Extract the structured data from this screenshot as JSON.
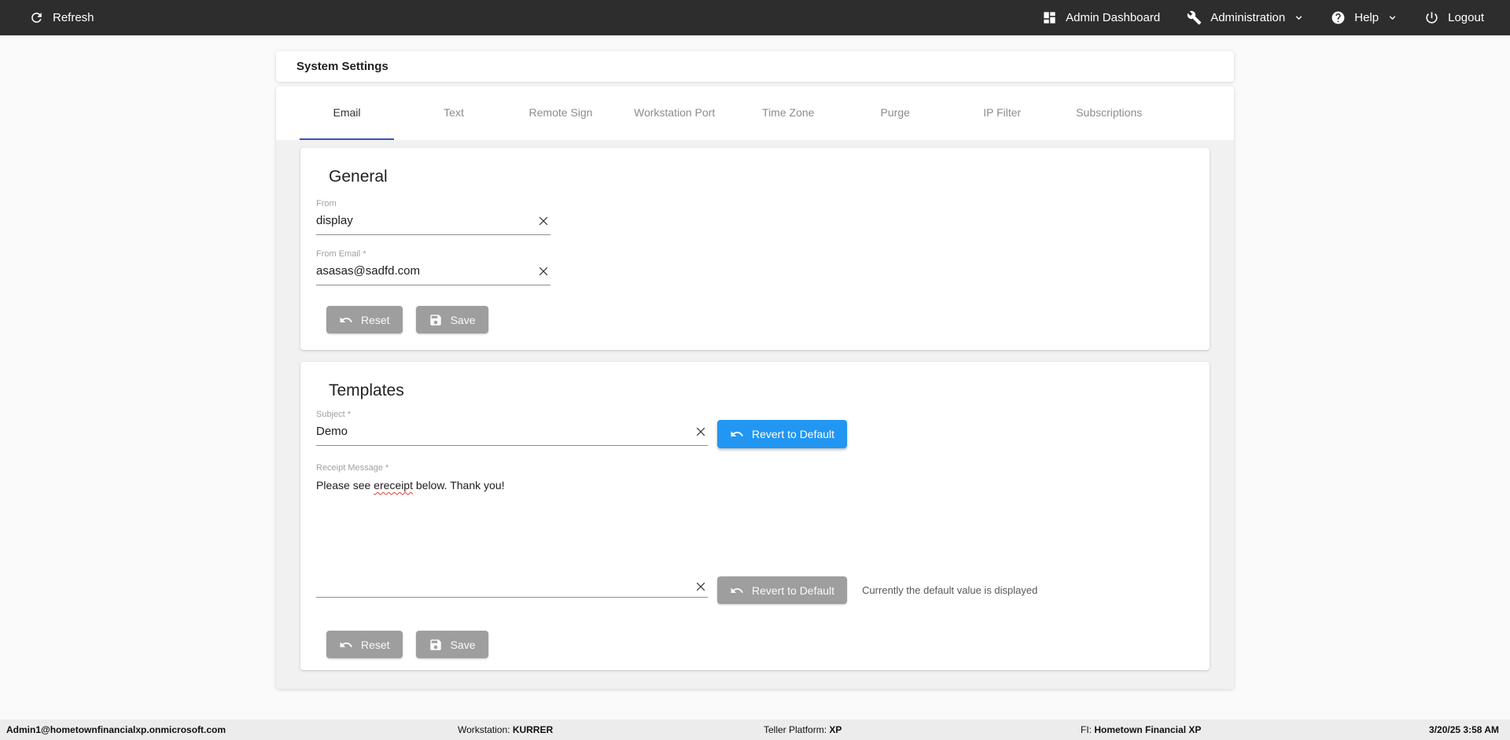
{
  "topbar": {
    "refresh": "Refresh",
    "admin_dashboard": "Admin Dashboard",
    "administration": "Administration",
    "help": "Help",
    "logout": "Logout"
  },
  "page": {
    "title": "System Settings"
  },
  "tabs": [
    {
      "label": "Email",
      "active": true
    },
    {
      "label": "Text",
      "active": false
    },
    {
      "label": "Remote Sign",
      "active": false
    },
    {
      "label": "Workstation Port",
      "active": false
    },
    {
      "label": "Time Zone",
      "active": false
    },
    {
      "label": "Purge",
      "active": false
    },
    {
      "label": "IP Filter",
      "active": false
    },
    {
      "label": "Subscriptions",
      "active": false
    }
  ],
  "general": {
    "heading": "General",
    "from_label": "From",
    "from_value": "display",
    "from_email_label": "From Email *",
    "from_email_value": "asasas@sadfd.com",
    "reset_label": "Reset",
    "save_label": "Save"
  },
  "templates": {
    "heading": "Templates",
    "subject_label": "Subject *",
    "subject_value": "Demo",
    "revert_label": "Revert to Default",
    "receipt_label": "Receipt Message *",
    "receipt_prefix": "Please see ",
    "receipt_misspelled": "ereceipt",
    "receipt_suffix": " below. Thank you!",
    "revert_disabled_label": "Revert to Default",
    "default_note": "Currently the default value is displayed",
    "reset_label": "Reset",
    "save_label": "Save"
  },
  "footer": {
    "user": "Admin1@hometownfinancialxp.onmicrosoft.com",
    "workstation_label": "Workstation: ",
    "workstation_value": "KURRER",
    "platform_label": "Teller Platform: ",
    "platform_value": "XP",
    "fi_label": "FI: ",
    "fi_value": "Hometown Financial XP",
    "datetime": "3/20/25 3:58 AM"
  },
  "colors": {
    "topbar_bg": "#2d2d2d",
    "accent_tab": "#3f51b5",
    "primary_button": "#2196f3",
    "disabled_button": "#9e9e9e",
    "content_bg": "#f1f1f1",
    "footer_bg": "#ececec",
    "spellcheck_red": "#e53935"
  }
}
